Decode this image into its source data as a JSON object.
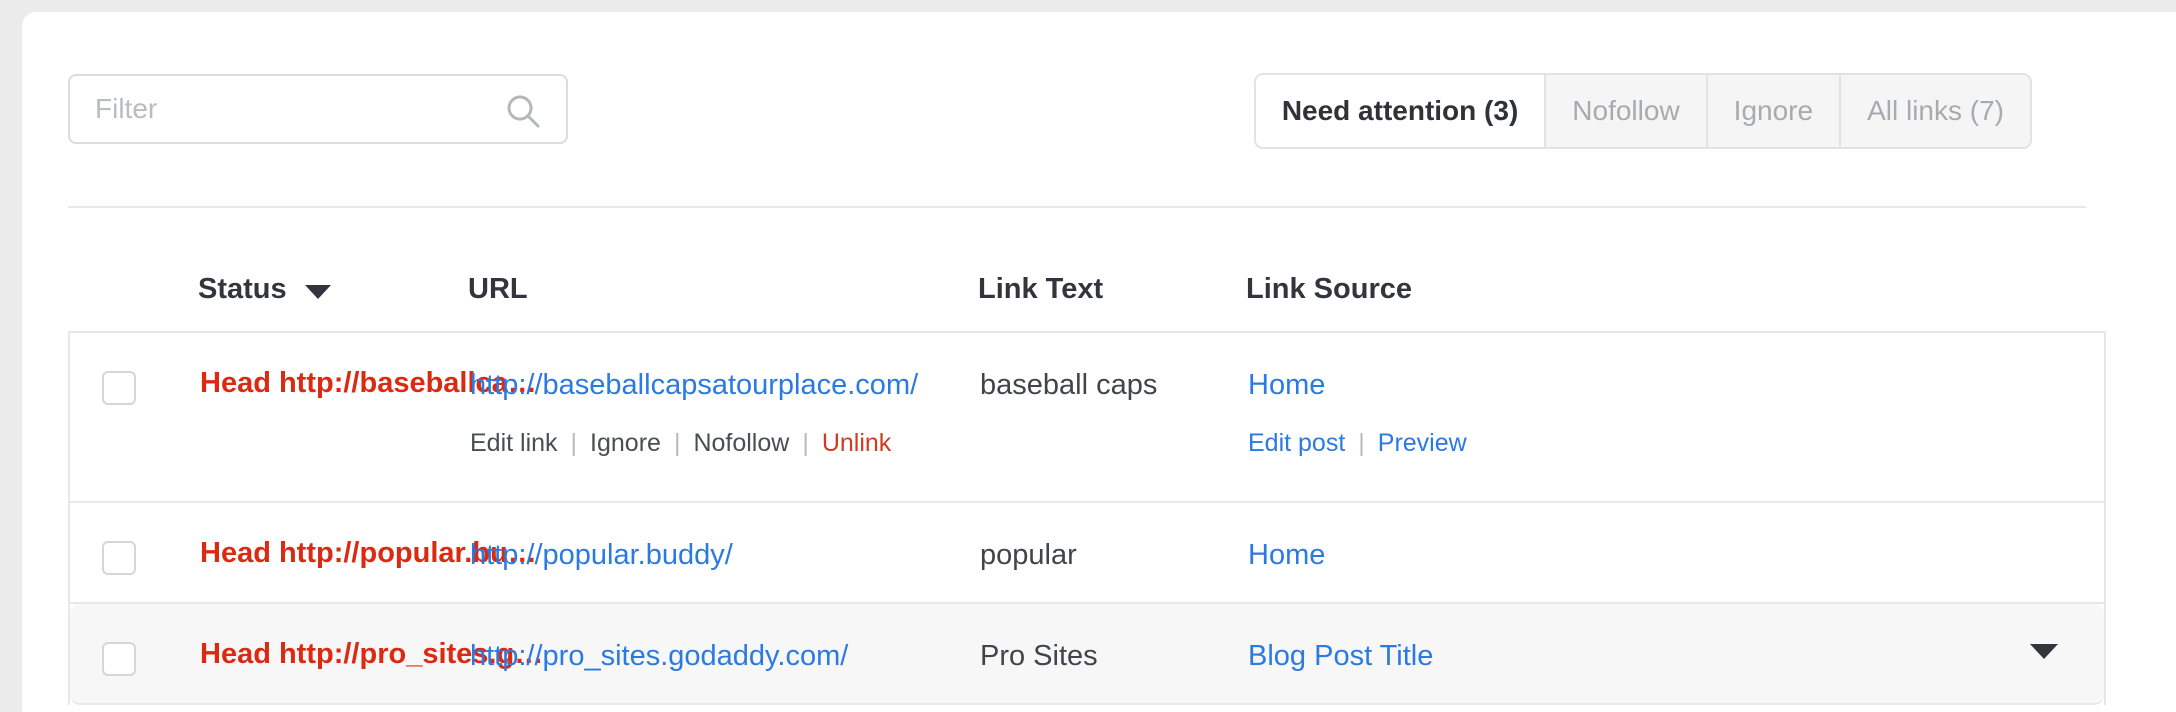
{
  "filter": {
    "placeholder": "Filter",
    "value": "",
    "icon": "search-icon"
  },
  "tabs": [
    {
      "label": "Need attention (3)",
      "active": true
    },
    {
      "label": "Nofollow",
      "active": false
    },
    {
      "label": "Ignore",
      "active": false
    },
    {
      "label": "All links (7)",
      "active": false
    }
  ],
  "table": {
    "headers": {
      "status": "Status",
      "url": "URL",
      "link_text": "Link Text",
      "link_source": "Link Source"
    },
    "sort_icon": "caret-down-icon",
    "rows": [
      {
        "checked": false,
        "status": "Head http://baseballca…",
        "url": "http://baseballcapsatourplace.com/",
        "link_text": "baseball caps",
        "link_source": "Home",
        "row_actions": [
          "Edit link",
          "Ignore",
          "Nofollow",
          "Unlink"
        ],
        "post_actions": [
          "Edit post",
          "Preview"
        ],
        "highlight": false,
        "expanded": true
      },
      {
        "checked": false,
        "status": "Head http://popular.bu…",
        "url": "http://popular.buddy/",
        "link_text": "popular",
        "link_source": "Home",
        "row_actions": [],
        "post_actions": [],
        "highlight": false,
        "expanded": false
      },
      {
        "checked": false,
        "status": "Head http://pro_sites.g…",
        "url": "http://pro_sites.godaddy.com/",
        "link_text": "Pro Sites",
        "link_source": "Blog Post Title",
        "row_actions": [],
        "post_actions": [],
        "highlight": true,
        "expanded": false,
        "caret_icon": "caret-down-icon"
      }
    ]
  },
  "colors": {
    "status_red": "#dc2a12",
    "link_blue": "#2a7ae2",
    "unlink_red": "#d03c1e",
    "text_dark": "#32363c",
    "muted": "#a7abb0",
    "border": "#e8e8e8",
    "highlight_bg": "#f7f7f8"
  }
}
